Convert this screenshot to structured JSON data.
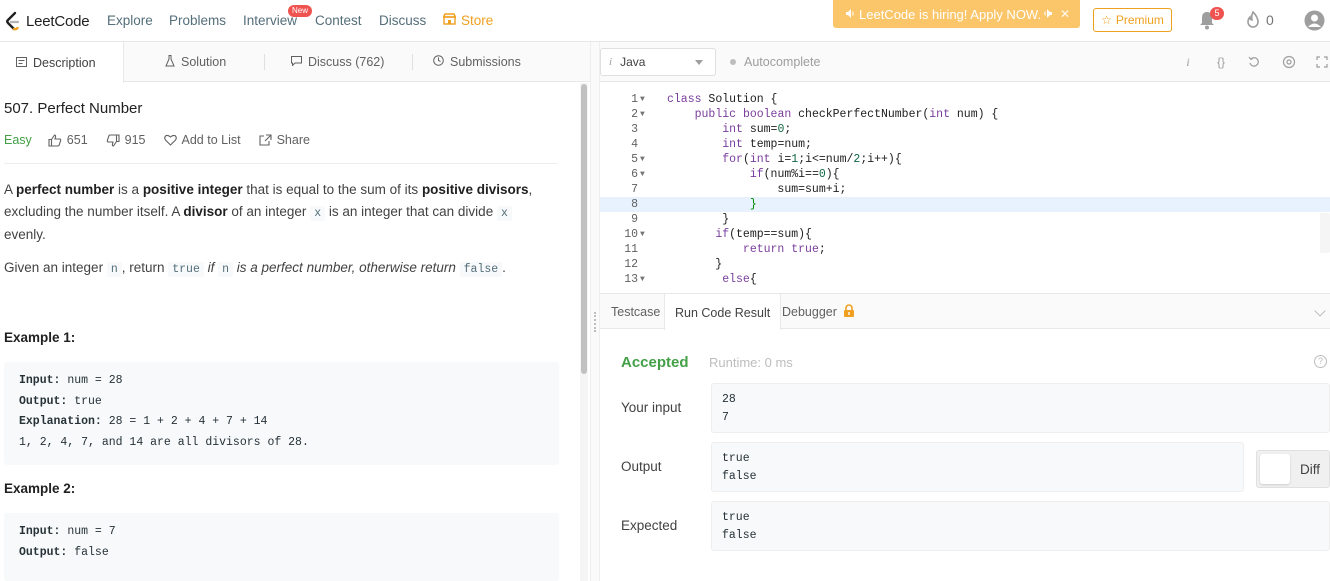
{
  "nav": {
    "logo_text": "LeetCode",
    "links": [
      "Explore",
      "Problems",
      "Interview",
      "Contest",
      "Discuss"
    ],
    "interview_badge": "New",
    "store": "Store",
    "hiring_banner": "LeetCode is hiring! Apply NOW.",
    "premium": "Premium",
    "notification_count": "5",
    "streak_count": "0"
  },
  "left_tabs": [
    "Description",
    "Solution",
    "Discuss (762)",
    "Submissions"
  ],
  "problem": {
    "title": "507. Perfect Number",
    "difficulty": "Easy",
    "likes": "651",
    "dislikes": "915",
    "add_to_list": "Add to List",
    "share": "Share",
    "para1": {
      "t1": "A ",
      "b1": "perfect number",
      "t2": " is a ",
      "b2": "positive integer",
      "t3": " that is equal to the sum of its ",
      "b3": "positive divisors",
      "t4": ", excluding the number itself. A ",
      "b4": "divisor",
      "t5": " of an integer ",
      "c1": "x",
      "t6": " is an integer that can divide ",
      "c2": "x",
      "t7": " evenly."
    },
    "para2": {
      "t1": "Given an integer ",
      "c1": "n",
      "t2": ", return ",
      "c2": "true",
      "i1": " if ",
      "c3": "n",
      "i2": " is a perfect number, otherwise return ",
      "c4": "false",
      "t3": "."
    },
    "example1": {
      "heading": "Example 1:",
      "input_label": "Input:",
      "input": " num = 28",
      "output_label": "Output:",
      "output": " true",
      "explanation_label": "Explanation:",
      "explanation": " 28 = 1 + 2 + 4 + 7 + 14",
      "extra": "1, 2, 4, 7, and 14 are all divisors of 28."
    },
    "example2": {
      "heading": "Example 2:",
      "input_label": "Input:",
      "input": " num = 7",
      "output_label": "Output:",
      "output": " false"
    }
  },
  "editor": {
    "language": "Java",
    "autocomplete": "Autocomplete",
    "lines": [
      [
        "1",
        "class Solution {"
      ],
      [
        "2",
        "    public boolean checkPerfectNumber(int num) {"
      ],
      [
        "3",
        "        int sum=0;"
      ],
      [
        "4",
        "        int temp=num;"
      ],
      [
        "5",
        "        for(int i=1;i<=num/2;i++){"
      ],
      [
        "6",
        "            if(num%i==0){"
      ],
      [
        "7",
        "                sum=sum+i;"
      ],
      [
        "8",
        "            }"
      ],
      [
        "9",
        "        }"
      ],
      [
        "10",
        "       if(temp==sum){"
      ],
      [
        "11",
        "           return true;"
      ],
      [
        "12",
        "       }"
      ],
      [
        "13",
        "        else{"
      ]
    ]
  },
  "console": {
    "tabs": [
      "Testcase",
      "Run Code Result",
      "Debugger"
    ],
    "status": "Accepted",
    "runtime": "Runtime: 0 ms",
    "help": "?",
    "your_input_label": "Your input",
    "your_input": [
      "28",
      "7"
    ],
    "output_label": "Output",
    "output": [
      "true",
      "false"
    ],
    "expected_label": "Expected",
    "expected": [
      "true",
      "false"
    ],
    "diff": "Diff"
  },
  "colors": {
    "accent_orange": "#f0a020",
    "accepted_green": "#43a047",
    "easy_green": "#43a047",
    "badge_red": "#ef5350"
  }
}
